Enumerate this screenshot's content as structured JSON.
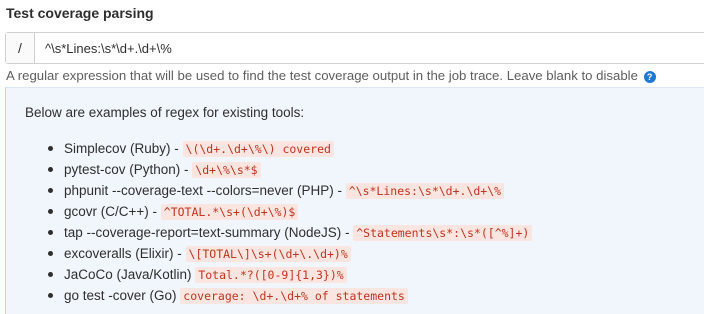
{
  "section": {
    "title": "Test coverage parsing"
  },
  "coverage_input": {
    "prefix": "/",
    "value": "^\\s*Lines:\\s*\\d+.\\d+\\%"
  },
  "help": {
    "text": "A regular expression that will be used to find the test coverage output in the job trace. Leave blank to disable",
    "icon": "question-circle-icon",
    "icon_glyph": "?"
  },
  "examples": {
    "intro": "Below are examples of regex for existing tools:",
    "items": [
      {
        "tool": "Simplecov (Ruby) - ",
        "regex": "\\(\\d+.\\d+\\%\\) covered"
      },
      {
        "tool": "pytest-cov (Python) - ",
        "regex": "\\d+\\%\\s*$"
      },
      {
        "tool": "phpunit --coverage-text --colors=never (PHP) - ",
        "regex": "^\\s*Lines:\\s*\\d+.\\d+\\%"
      },
      {
        "tool": "gcovr (C/C++) - ",
        "regex": "^TOTAL.*\\s+(\\d+\\%)$"
      },
      {
        "tool": "tap --coverage-report=text-summary (NodeJS) - ",
        "regex": "^Statements\\s*:\\s*([^%]+)"
      },
      {
        "tool": "excoveralls (Elixir) - ",
        "regex": "\\[TOTAL\\]\\s+(\\d+\\.\\d+)%"
      },
      {
        "tool": "JaCoCo (Java/Kotlin) ",
        "regex": "Total.*?([0-9]{1,3})%"
      },
      {
        "tool": "go test -cover (Go) ",
        "regex": "coverage: \\d+.\\d+% of statements"
      }
    ]
  },
  "colors": {
    "code_text": "#c0341d",
    "code_bg": "#fbe5e1",
    "info_box_bg": "#f0f6fb",
    "help_icon": "#1f78d1"
  }
}
